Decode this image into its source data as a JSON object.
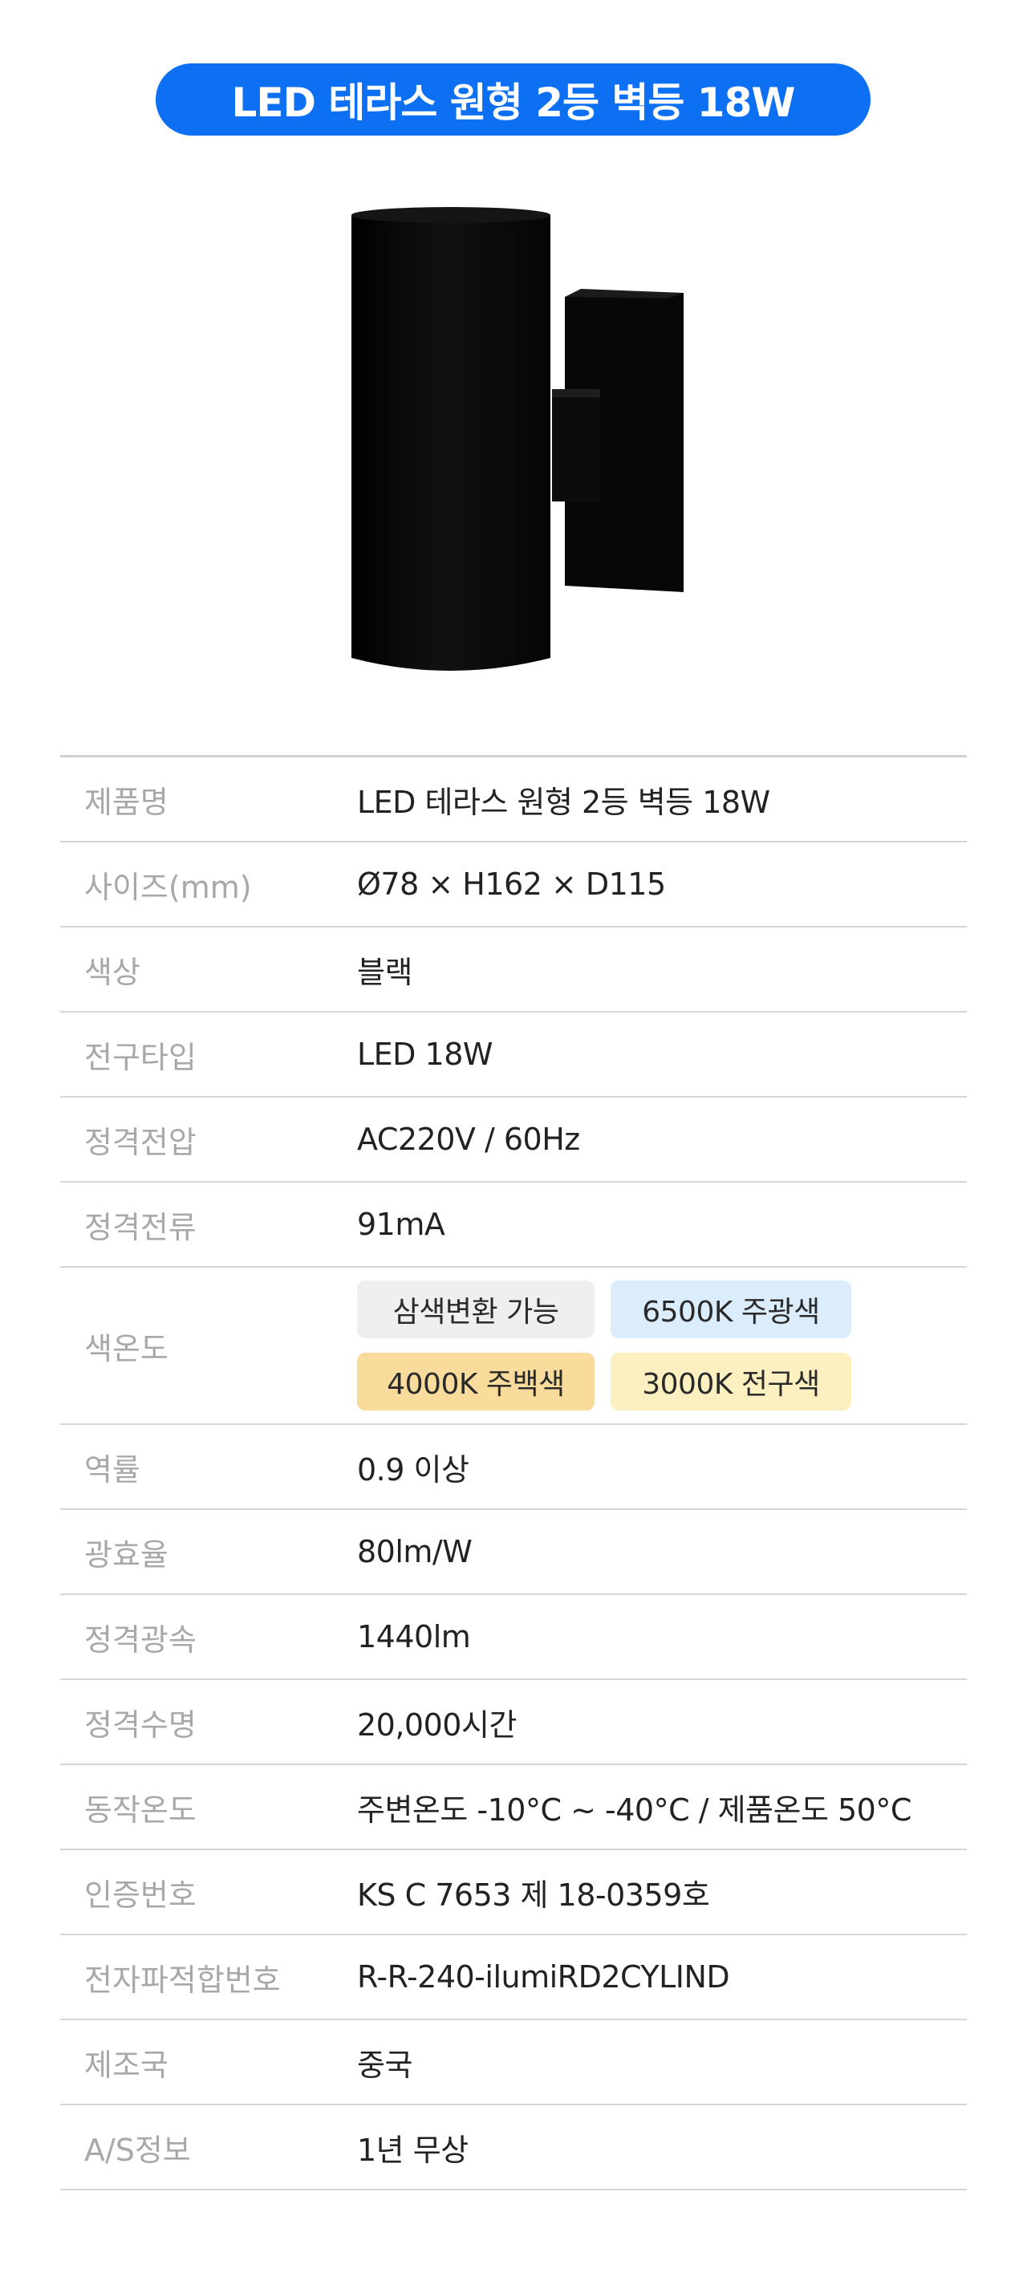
{
  "header": {
    "title": "LED 테라스 원형 2등 벽등 18W"
  },
  "product_image": {
    "icon": "cylinder-wall-lamp-icon",
    "body_color": "#0a0a0a"
  },
  "specs": [
    {
      "label": "제품명",
      "value": "LED 테라스 원형 2등 벽등 18W"
    },
    {
      "label": "사이즈(mm)",
      "value": "Ø78 × H162 × D115"
    },
    {
      "label": "색상",
      "value": "블랙"
    },
    {
      "label": "전구타입",
      "value": "LED 18W"
    },
    {
      "label": "정격전압",
      "value": "AC220V / 60Hz"
    },
    {
      "label": "정격전류",
      "value": "91mA"
    },
    {
      "label": "색온도",
      "chips": [
        {
          "text": "삼색변환 가능",
          "color": "#efefef"
        },
        {
          "text": "6500K 주광색",
          "color": "#dbecfa"
        },
        {
          "text": "4000K 주백색",
          "color": "#f9dc9b"
        },
        {
          "text": "3000K 전구색",
          "color": "#fdf0c0"
        }
      ]
    },
    {
      "label": "역률",
      "value": "0.9 이상"
    },
    {
      "label": "광효율",
      "value": "80lm/W"
    },
    {
      "label": "정격광속",
      "value": "1440lm"
    },
    {
      "label": "정격수명",
      "value": "20,000시간"
    },
    {
      "label": "동작온도",
      "value": "주변온도 -10°C ~ -40°C / 제품온도 50°C"
    },
    {
      "label": "인증번호",
      "value": "KS C 7653 제 18-0359호"
    },
    {
      "label": "전자파적합번호",
      "value": "R-R-240-ilumiRD2CYLIND"
    },
    {
      "label": "제조국",
      "value": "중국"
    },
    {
      "label": "A/S정보",
      "value": "1년 무상"
    }
  ]
}
